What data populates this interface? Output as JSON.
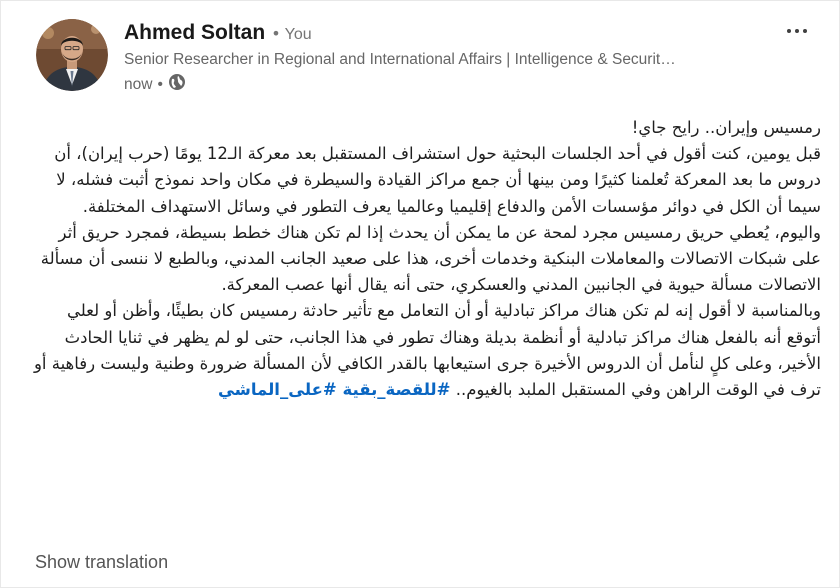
{
  "author": {
    "name": "Ahmed Soltan",
    "you_label": "You",
    "headline": "Senior Researcher in Regional and International Affairs | Intelligence & Securit…",
    "time": "now",
    "visibility_icon": "globe-icon"
  },
  "post": {
    "paragraphs": [
      "رمسيس وإيران.. رايح جاي!",
      "قبل يومين، كنت أقول في أحد الجلسات البحثية حول استشراف المستقبل بعد معركة الـ12 يومًا (حرب إيران)، أن دروس ما بعد المعركة تُعلمنا كثيرًا ومن بينها أن جمع مراكز القيادة والسيطرة في مكان واحد نموذج أثبت فشله، لا سيما أن الكل في دوائر مؤسسات الأمن والدفاع إقليميا وعالميا يعرف التطور في وسائل الاستهداف المختلفة.",
      "واليوم، يُعطي حريق رمسيس مجرد لمحة عن ما يمكن أن يحدث إذا لم تكن هناك خطط بسيطة، فمجرد حريق أثر على شبكات الاتصالات والمعاملات البنكية وخدمات أخرى، هذا على صعيد الجانب المدني، وبالطبع لا ننسى أن مسألة الاتصالات مسألة حيوية في الجانبين المدني والعسكري، حتى أنه يقال أنها عصب المعركة.",
      "وبالمناسبة لا أقول إنه لم تكن هناك مراكز تبادلية أو أن التعامل مع تأثير حادثة رمسيس كان بطيئًا، وأظن أو لعلي أتوقع أنه بالفعل هناك مراكز تبادلية أو أنظمة بديلة وهناك تطور في هذا الجانب، حتى لو لم يظهر في ثنايا الحادث الأخير، وعلى كلٍ لنأمل أن الدروس الأخيرة جرى استيعابها بالقدر الكافي لأن المسألة ضرورة وطنية وليست رفاهية أو ترف في الوقت الراهن وفي المستقبل الملبد بالغيوم.."
    ],
    "hashtag": "#للقصة_بقية #على_الماشي"
  },
  "actions": {
    "show_translation": "Show translation"
  },
  "colors": {
    "link": "#0a66c2",
    "secondary_text": "#666666",
    "primary_text": "#191919"
  }
}
